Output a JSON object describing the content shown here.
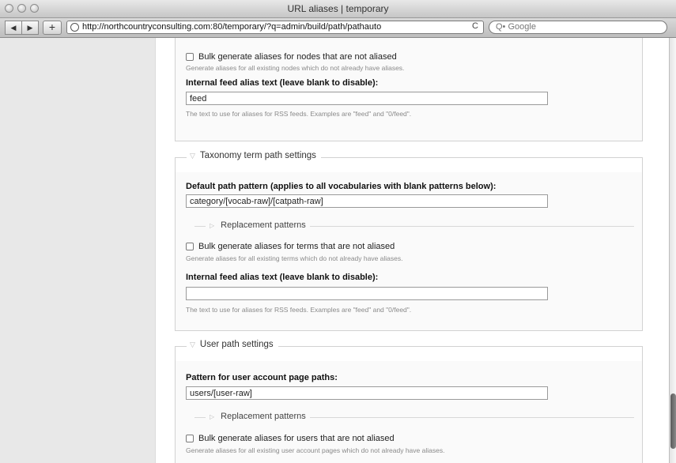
{
  "window": {
    "title": "URL aliases | temporary"
  },
  "toolbar": {
    "back_label": "◀",
    "forward_label": "▶",
    "add_label": "+",
    "url": "http://northcountryconsulting.com:80/temporary/?q=admin/build/path/pathauto",
    "reload_label": "C",
    "search_placeholder": "Q• Google"
  },
  "node_section": {
    "bulk_label": "Bulk generate aliases for nodes that are not aliased",
    "bulk_desc": "Generate aliases for all existing nodes which do not already have aliases.",
    "feed_label": "Internal feed alias text (leave blank to disable):",
    "feed_value": "feed",
    "feed_desc": "The text to use for aliases for RSS feeds. Examples are \"feed\" and \"0/feed\"."
  },
  "taxonomy_section": {
    "legend": "Taxonomy term path settings",
    "pattern_label": "Default path pattern (applies to all vocabularies with blank patterns below):",
    "pattern_value": "category/[vocab-raw]/[catpath-raw]",
    "replacement_label": "Replacement patterns",
    "bulk_label": "Bulk generate aliases for terms that are not aliased",
    "bulk_desc": "Generate aliases for all existing terms which do not already have aliases.",
    "feed_label": "Internal feed alias text (leave blank to disable):",
    "feed_value": "",
    "feed_desc": "The text to use for aliases for RSS feeds. Examples are \"feed\" and \"0/feed\"."
  },
  "user_section": {
    "legend": "User path settings",
    "pattern_label": "Pattern for user account page paths:",
    "pattern_value": "users/[user-raw]",
    "replacement_label": "Replacement patterns",
    "bulk_label": "Bulk generate aliases for users that are not aliased",
    "bulk_desc": "Generate aliases for all existing user account pages which do not already have aliases."
  }
}
